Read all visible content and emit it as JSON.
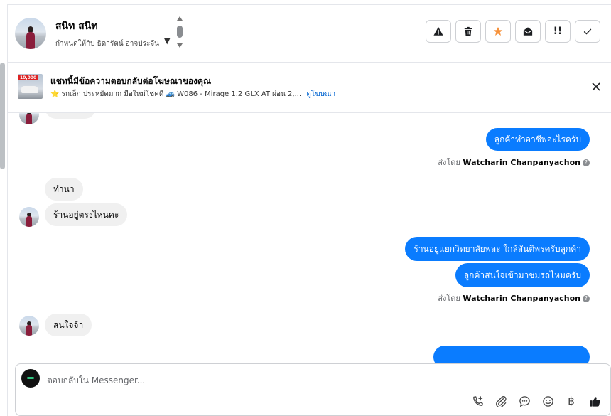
{
  "header": {
    "user_name": "สนิท สนิท",
    "assign_label": "กำหนดให้กับ ธิดารัตน์ อาจประจัน",
    "actions": [
      {
        "name": "report-spam-button",
        "icon": "warning-icon"
      },
      {
        "name": "delete-button",
        "icon": "trash-icon"
      },
      {
        "name": "star-button",
        "icon": "star-icon"
      },
      {
        "name": "mark-unread-button",
        "icon": "envelope-open-icon"
      },
      {
        "name": "follow-up-button",
        "icon": "exclamation-icon"
      },
      {
        "name": "mark-done-button",
        "icon": "check-icon"
      }
    ],
    "follow_up_glyph": "!!"
  },
  "ad": {
    "title": "แชทนี้มีข้อความตอบกลับต่อโฆษณาของคุณ",
    "thumb_price": "10,000",
    "description": "⭐ รถเล็ก ประหยัดมาก มือใหม่โชคดี 🚙 W086 - Mirage 1.2 GLX AT ผ่อน 2,...",
    "link_label": "ดูโฆษณา"
  },
  "messages": [
    {
      "dir": "out",
      "text": "ลูกค้าทำอาชีพอะไรครับ"
    },
    {
      "dir": "meta",
      "prefix": "ส่งโดย",
      "name": "Watcharin Chanpanyachon"
    },
    {
      "dir": "in",
      "text": "ทำนา"
    },
    {
      "dir": "in",
      "text": "ร้านอยู่ตรงไหนคะ"
    },
    {
      "dir": "out",
      "text": "ร้านอยู่แยกวิทยาลัยพละ ใกล้สันติพรครับลูกค้า"
    },
    {
      "dir": "out",
      "text": "ลูกค้าสนใจเข้ามาชมรถไหมครับ"
    },
    {
      "dir": "meta",
      "prefix": "ส่งโดย",
      "name": "Watcharin Chanpanyachon"
    },
    {
      "dir": "in",
      "text": "สนใจจ้า"
    }
  ],
  "composer": {
    "placeholder": "ตอบกลับใน Messenger...",
    "tools": [
      "phone-plus-icon",
      "paperclip-icon",
      "saved-reply-icon",
      "emoji-icon",
      "baht-icon",
      "thumbs-up-icon"
    ],
    "baht_glyph": "฿"
  },
  "colors": {
    "accent": "#0a7cff",
    "star": "#f7923b",
    "incoming_bubble": "#f0f0f0"
  }
}
